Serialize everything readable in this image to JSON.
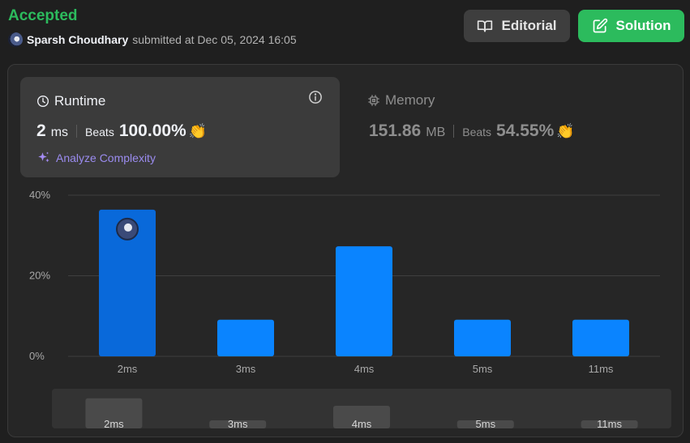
{
  "header": {
    "status": "Accepted",
    "user": "Sparsh Choudhary",
    "submitted_text": "submitted at Dec 05, 2024 16:05"
  },
  "buttons": {
    "editorial": "Editorial",
    "solution": "Solution"
  },
  "runtime": {
    "title": "Runtime",
    "value": "2",
    "unit": "ms",
    "beats_label": "Beats",
    "beats": "100.00%",
    "analyze": "Analyze Complexity"
  },
  "memory": {
    "title": "Memory",
    "value": "151.86",
    "unit": "MB",
    "beats_label": "Beats",
    "beats": "54.55%"
  },
  "colors": {
    "accepted": "#2cbb5d",
    "bar": "#0a84ff",
    "bar_active": "#0969da"
  },
  "chart_data": {
    "type": "bar",
    "categories": [
      "2ms",
      "3ms",
      "4ms",
      "5ms",
      "11ms"
    ],
    "values": [
      36.4,
      9.1,
      27.3,
      9.1,
      9.1
    ],
    "ylim": [
      0,
      40
    ],
    "yticks": [
      "0%",
      "20%",
      "40%"
    ],
    "ytick_values": [
      0,
      20,
      40
    ],
    "highlighted": "2ms",
    "grid": true,
    "overview": {
      "categories": [
        "2ms",
        "3ms",
        "4ms",
        "5ms",
        "11ms"
      ],
      "values": [
        36.4,
        9.1,
        27.3,
        9.1,
        9.1
      ]
    }
  }
}
